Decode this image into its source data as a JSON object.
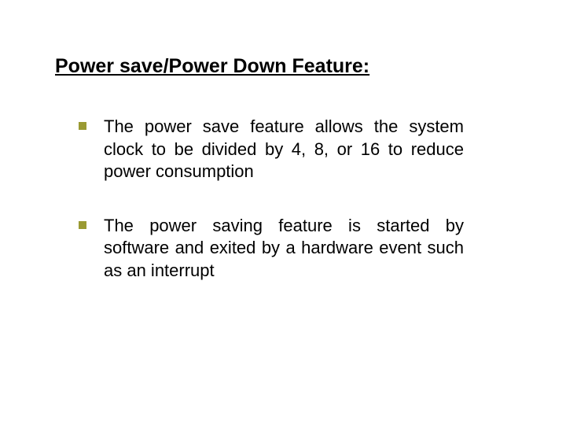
{
  "title": "Power save/Power Down Feature:",
  "bullets": [
    "The power save feature allows the system clock to be divided by 4, 8, or 16 to reduce power consumption",
    "The power saving feature is started by software and exited by a hardware event such as an interrupt"
  ],
  "bullet_color": "#9a9a33"
}
